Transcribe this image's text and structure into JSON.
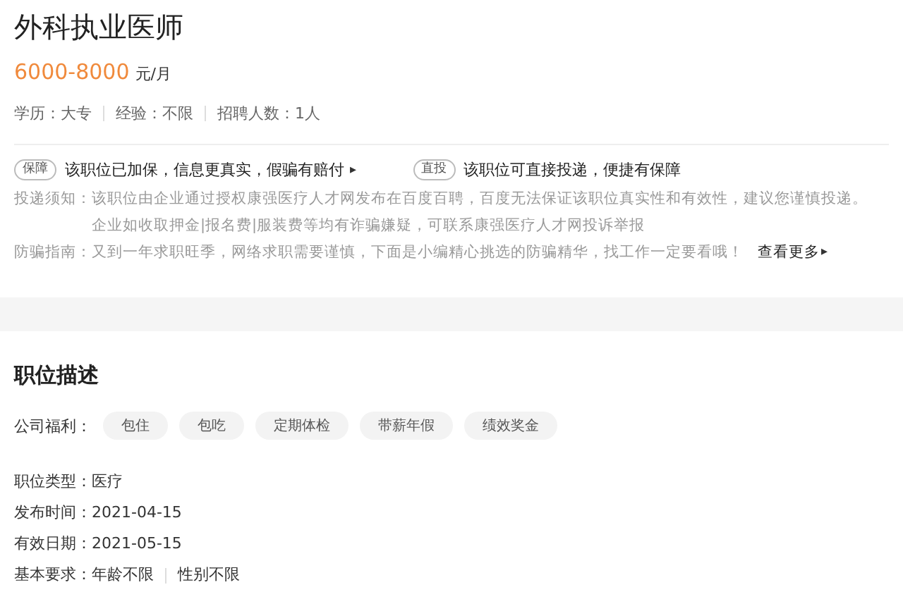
{
  "title": "外科执业医师",
  "salary": {
    "amount": "6000-8000",
    "unit": "元/月"
  },
  "requirements": [
    "学历：大专",
    "经验：不限",
    "招聘人数：1人"
  ],
  "guarantees": [
    {
      "badge": "保障",
      "text": "该职位已加保，信息更真实，假骗有赔付",
      "arrow": "▸"
    },
    {
      "badge": "直投",
      "text": "该职位可直接投递，便捷有保障"
    }
  ],
  "notice": {
    "label": "投递须知：",
    "lines": [
      "该职位由企业通过授权康强医疗人才网发布在百度百聘，百度无法保证该职位真实性和有效性，建议您谨慎投递。",
      "企业如收取押金|报名费|服装费等均有诈骗嫌疑，可联系康强医疗人才网投诉举报"
    ]
  },
  "fraud": {
    "label": "防骗指南：",
    "text": "又到一年求职旺季，网络求职需要谨慎，下面是小编精心挑选的防骗精华，找工作一定要看哦！",
    "link": "查看更多",
    "arrow": "▸"
  },
  "section_title": "职位描述",
  "welfare": {
    "label": "公司福利：",
    "tags": [
      "包住",
      "包吃",
      "定期体检",
      "带薪年假",
      "绩效奖金"
    ]
  },
  "details": [
    {
      "label": "职位类型：",
      "values": [
        "医疗"
      ]
    },
    {
      "label": "发布时间：",
      "values": [
        "2021-04-15"
      ]
    },
    {
      "label": "有效日期：",
      "values": [
        "2021-05-15"
      ]
    },
    {
      "label": "基本要求：",
      "values": [
        "年龄不限",
        "性别不限"
      ]
    }
  ]
}
